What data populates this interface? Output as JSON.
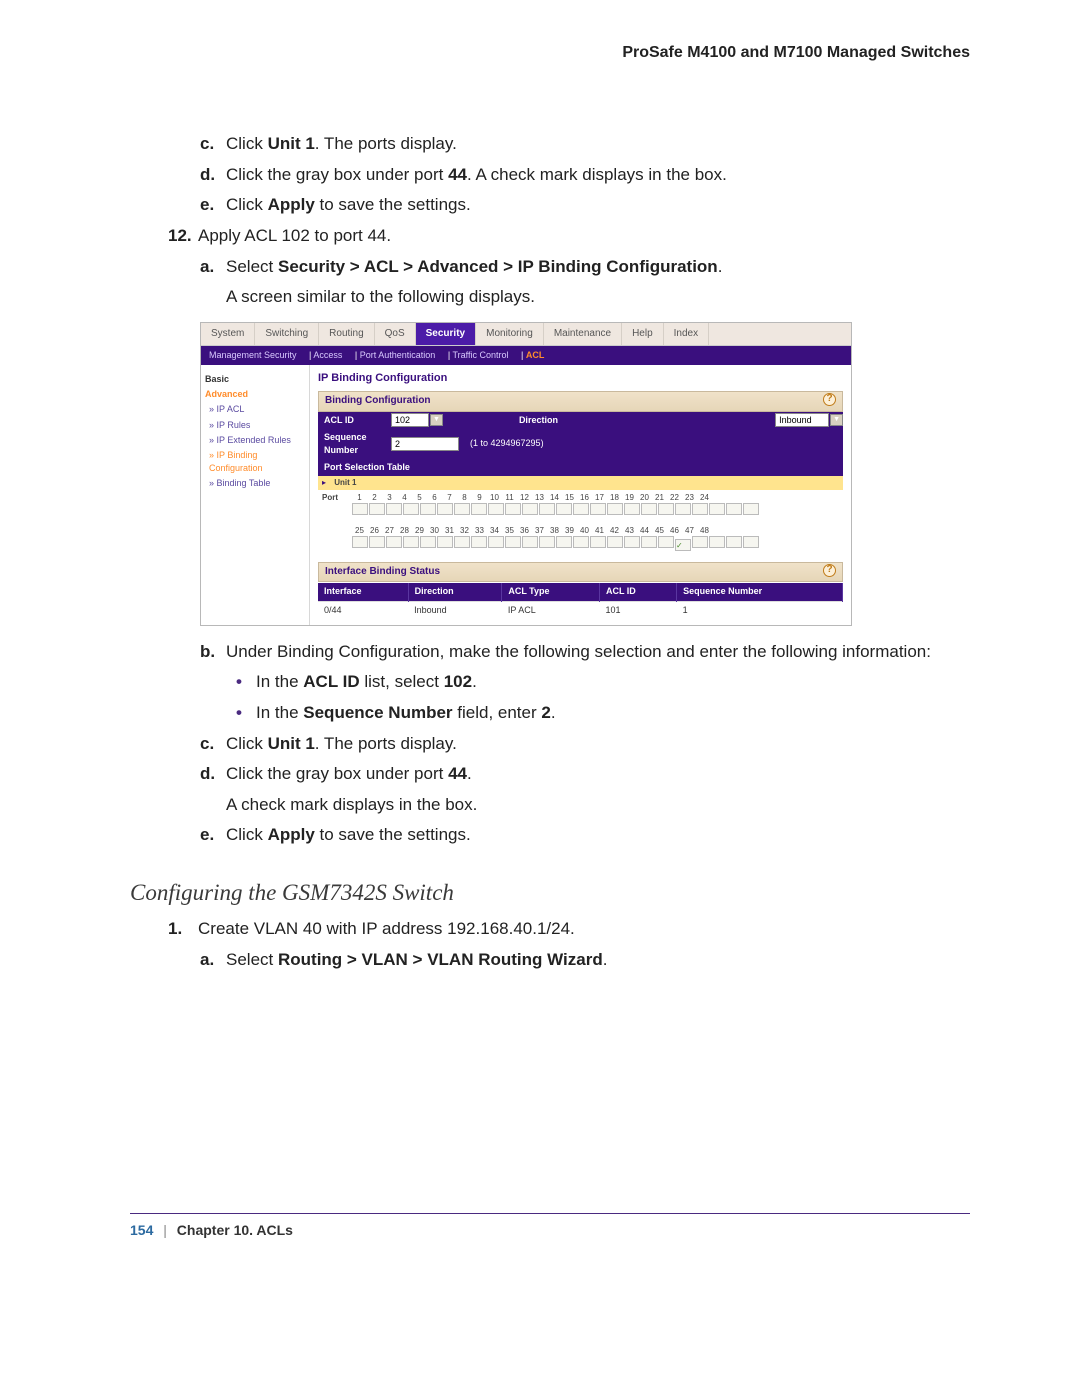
{
  "header": {
    "product": "ProSafe M4100 and M7100 Managed Switches"
  },
  "steps": {
    "c1": "Click ",
    "c1b": "Unit 1",
    "c1t": ". The ports display.",
    "d1": "Click the gray box under port ",
    "d1b": "44",
    "d1t": ". A check mark displays in the box.",
    "e1": "Click ",
    "e1b": "Apply",
    "e1t": " to save the settings.",
    "s12": "Apply ACL 102 to port 44.",
    "a2": "Select ",
    "a2b": "Security > ACL > Advanced > IP Binding Configuration",
    "a2t": ".",
    "a2post": "A screen similar to the following displays.",
    "b2": "Under Binding Configuration, make the following selection and enter the following information:",
    "bul1a": "In the ",
    "bul1b": "ACL ID",
    "bul1c": " list, select ",
    "bul1d": "102",
    "bul1e": ".",
    "bul2a": "In the ",
    "bul2b": "Sequence Number",
    "bul2c": " field, enter ",
    "bul2d": "2",
    "bul2e": ".",
    "c3": "Click ",
    "c3b": "Unit 1",
    "c3t": ". The ports display.",
    "d3": "Click the gray box under port ",
    "d3b": "44",
    "d3t": ".",
    "d3post": "A check mark displays in the box.",
    "e3": "Click ",
    "e3b": "Apply",
    "e3t": " to save the settings."
  },
  "section2": {
    "heading": "Configuring the GSM7342S Switch",
    "s1": "Create VLAN 40 with IP address 192.168.40.1/24.",
    "a": "Select ",
    "ab": "Routing > VLAN > VLAN Routing Wizard",
    "at": "."
  },
  "shot": {
    "tabs": [
      "System",
      "Switching",
      "Routing",
      "QoS",
      "Security",
      "Monitoring",
      "Maintenance",
      "Help",
      "Index"
    ],
    "active_tab": 4,
    "subtabs": [
      "Management Security",
      "Access",
      "Port Authentication",
      "Traffic Control",
      "ACL"
    ],
    "active_sub": 4,
    "side": {
      "basic": "Basic",
      "advanced": "Advanced",
      "items": [
        "IP ACL",
        "IP Rules",
        "IP Extended Rules",
        "IP Binding Configuration",
        "Binding Table"
      ],
      "active": 3
    },
    "title": "IP Binding Configuration",
    "binding_title": "Binding Configuration",
    "acl_label": "ACL ID",
    "acl_value": "102",
    "dir_label": "Direction",
    "dir_value": "Inbound",
    "seq_label": "Sequence Number",
    "seq_value": "2",
    "seq_range": "(1 to 4294967295)",
    "pst": "Port Selection Table",
    "unit": "Unit 1",
    "port_label": "Port",
    "ports_top": [
      "1",
      "2",
      "3",
      "4",
      "5",
      "6",
      "7",
      "8",
      "9",
      "10",
      "11",
      "12",
      "13",
      "14",
      "15",
      "16",
      "17",
      "18",
      "19",
      "20",
      "21",
      "22",
      "23",
      "24"
    ],
    "ports_bot": [
      "25",
      "26",
      "27",
      "28",
      "29",
      "30",
      "31",
      "32",
      "33",
      "34",
      "35",
      "36",
      "37",
      "38",
      "39",
      "40",
      "41",
      "42",
      "43",
      "44",
      "45",
      "46",
      "47",
      "48"
    ],
    "checked_port_index": 19,
    "ibs_title": "Interface Binding Status",
    "ibs_headers": [
      "Interface",
      "Direction",
      "ACL Type",
      "ACL ID",
      "Sequence Number"
    ],
    "ibs_row": [
      "0/44",
      "Inbound",
      "IP ACL",
      "101",
      "1"
    ]
  },
  "footer": {
    "page": "154",
    "chapter": "Chapter 10.  ACLs"
  }
}
